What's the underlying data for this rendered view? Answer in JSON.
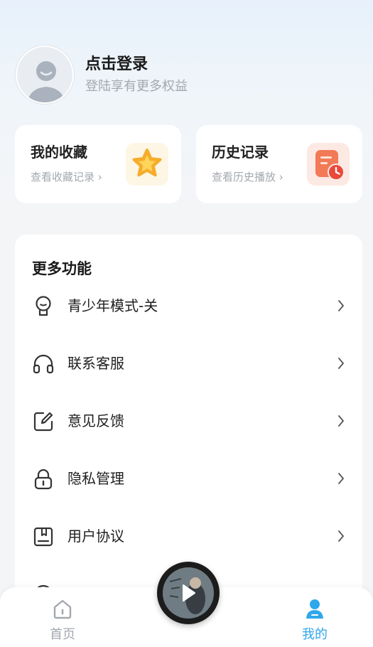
{
  "profile": {
    "title": "点击登录",
    "subtitle": "登陆享有更多权益",
    "avatar_icon": "user-avatar-placeholder"
  },
  "quick_cards": [
    {
      "title": "我的收藏",
      "subtitle": "查看收藏记录 ›",
      "icon": "star-icon",
      "accent": "#f7b733"
    },
    {
      "title": "历史记录",
      "subtitle": "查看历史播放 ›",
      "icon": "history-clock-icon",
      "accent": "#ee5b3e"
    }
  ],
  "more": {
    "title": "更多功能",
    "items": [
      {
        "label": "青少年模式-关",
        "icon": "youth-mode-icon"
      },
      {
        "label": "联系客服",
        "icon": "headphones-icon"
      },
      {
        "label": "意见反馈",
        "icon": "edit-feedback-icon"
      },
      {
        "label": "隐私管理",
        "icon": "lock-icon"
      },
      {
        "label": "用户协议",
        "icon": "agreement-book-icon"
      }
    ]
  },
  "tabbar": {
    "tabs": [
      {
        "label": "首页",
        "icon": "home-icon",
        "active": false
      },
      {
        "label": "我的",
        "icon": "user-icon",
        "active": true
      }
    ],
    "active_color": "#2fa7ec",
    "inactive_color": "#a3a8ae"
  },
  "player": {
    "icon": "play-icon"
  }
}
